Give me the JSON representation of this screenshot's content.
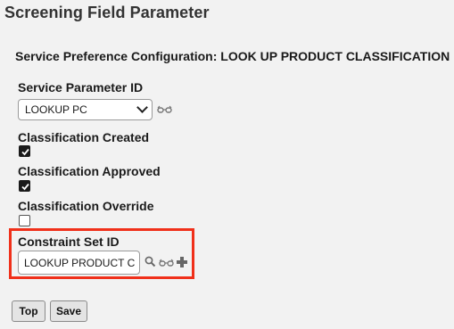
{
  "page": {
    "title": "Screening Field Parameter",
    "section_title": "Service Preference Configuration: LOOK UP PRODUCT CLASSIFICATION"
  },
  "fields": {
    "service_parameter_id": {
      "label": "Service Parameter ID",
      "value": "LOOKUP PC"
    },
    "classification_created": {
      "label": "Classification Created",
      "checked": true
    },
    "classification_approved": {
      "label": "Classification Approved",
      "checked": true
    },
    "classification_override": {
      "label": "Classification Override",
      "checked": false
    },
    "constraint_set_id": {
      "label": "Constraint Set ID",
      "value": "LOOKUP PRODUCT C"
    }
  },
  "buttons": {
    "top_label": "Top",
    "save_label": "Save"
  },
  "icons": {
    "view": "glasses-icon",
    "search": "search-icon",
    "add": "plus-icon"
  },
  "colors": {
    "highlight": "#f0301a",
    "background": "#f2f2f2"
  }
}
